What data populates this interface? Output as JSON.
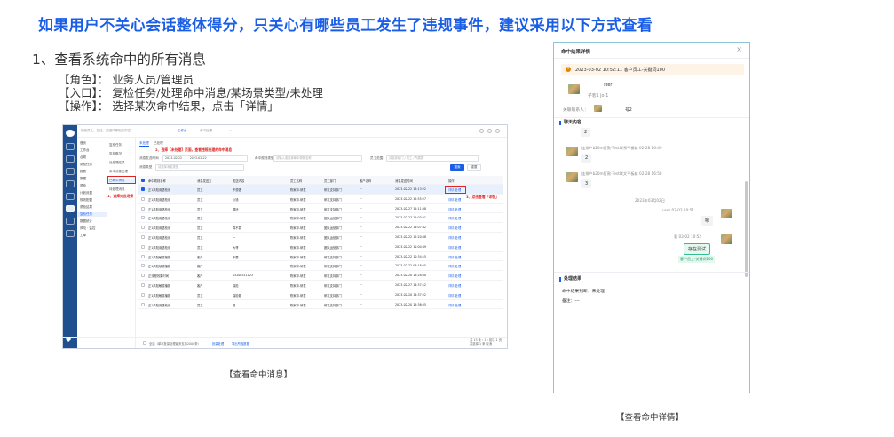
{
  "headline": "如果用户不关心会话整体得分，只关心有哪些员工发生了违规事件，建议采用以下方式查看",
  "subhead": "1、查看系统命中的所有消息",
  "info": {
    "role_label": "【角色】：",
    "role_value": "业务人员/管理员",
    "entry_label": "【入口】：",
    "entry_value": "复检任务/处理命中消息/某场景类型/未处理",
    "op_label": "【操作】：",
    "op_value": "选择某次命中结果，点击「详情」"
  },
  "captions": {
    "left": "【查看命中消息】",
    "right": "【查看命中详情】"
  },
  "screenshot": {
    "search_placeholder": "搜索员工、会话、关键词等相关内容",
    "top_tabs": [
      "工作台",
      "命中处理",
      "···"
    ],
    "nav1": [
      "首页",
      "工作台",
      "合规",
      "质检任务",
      "报表",
      "数据",
      "质检",
      "计划设置",
      "规则配置",
      "质检结果",
      "复检任务",
      "数据统计",
      "风险 · 监控",
      "工单"
    ],
    "nav1_active": "复检任务",
    "nav2": [
      "复检任务",
      "复检概况",
      "已处理结果",
      "命中消息处理",
      "已命中消息",
      "待处理消息"
    ],
    "nav2_active": "已命中消息",
    "content_tabs": [
      "未处理",
      "已处理"
    ],
    "filters": {
      "time_label": "消息发送时间",
      "time_start": "2023-02-22",
      "time_end": "2023-02-22",
      "scene_label": "命中规则类型",
      "scene_placeholder": "请输入或选择命中规则名称",
      "dept_label": "员工范围",
      "dept_placeholder": "请选择部门 / 员工 / 所属群",
      "type_label": "消息类型",
      "type_placeholder": "请选择消息类型"
    },
    "search_btn": "搜索",
    "reset_btn": "重置",
    "columns": [
      "命中规则名称",
      "消息发送方",
      "发送内容",
      "员工名称",
      "员工部门",
      "客户名称",
      "消息发送时间",
      "操作"
    ],
    "rows": [
      [
        "正1风险用语检测",
        "员工",
        "不想做",
        "陈家林-研发",
        "研发支持部门",
        "···",
        "2023-02-22 18:13:22",
        "详情  处理"
      ],
      [
        "正1风险用语检测",
        "员工",
        "价钱",
        "陈家林-研发",
        "研发支持部门",
        "···",
        "2023-02-22 15:55:27",
        "详情  处理"
      ],
      [
        "正1风险用语检测",
        "员工",
        "骚扰",
        "陈家林-研发",
        "研发支持部门",
        "···",
        "2023-02-27 15:11:08",
        "详情  处理"
      ],
      [
        "正1风险用语检测",
        "员工",
        "一",
        "陈家林-研发",
        "团队运营部门",
        "···",
        "2023-02-27 15:03:21",
        "详情  处理"
      ],
      [
        "正1风险用语检测",
        "员工",
        "算不算",
        "陈家林-研发",
        "团队运营部门",
        "···",
        "2023-02-22 14:07:42",
        "详情  处理"
      ],
      [
        "正1风险用语检测",
        "员工",
        "一",
        "陈家林-研发",
        "团队运营部门",
        "···",
        "2023-02-22 12:20:08",
        "详情  处理"
      ],
      [
        "正1风险用语检测",
        "员工",
        "大哥",
        "陈家林-研发",
        "团队运营部门",
        "···",
        "2023-02-22 11:04:09",
        "详情  处理"
      ],
      [
        "正1风险敏感播报",
        "客户",
        "不要",
        "陈家林-研发",
        "研发支持部门",
        "···",
        "2023-02-22 10:34:15",
        "详情  处理"
      ],
      [
        "正1风险敏感播报",
        "客户",
        "一",
        "陈家林-研发",
        "研发支持部门",
        "···",
        "2023-02-22 09:18:55",
        "详情  处理"
      ],
      [
        "正流程效果时间",
        "客户",
        "15208511023",
        "陈家林-研发",
        "研发支持部门",
        "···",
        "2023-02-20 18:28:00",
        "详情  处理"
      ],
      [
        "正1风险敏感播报",
        "客户",
        "保险",
        "陈家林-研发",
        "研发支持部门",
        "···",
        "2023-02-27 14:37:12",
        "详情  处理"
      ],
      [
        "正1风险敏感播报",
        "员工",
        "保险箱",
        "陈家林-研发",
        "研发支持部门",
        "···",
        "2023-02-20 14:37:22",
        "详情  处理"
      ],
      [
        "正1风险用语检测",
        "员工",
        "提",
        "陈家林-研发",
        "研发支持部门",
        "···",
        "2023-02-20 14:36:55",
        "详情  处理"
      ]
    ],
    "pager": "共 13 条   ‹  1  ›   前往  1  页",
    "footer_left": "全选（单次批量处理最多支持2000条）",
    "footer_btn1": "批量处理",
    "footer_btn2": "导出所选数据",
    "footer_right": "共选择 1 条   取消",
    "annot1": "2、选择【未处理】页面，查看违规处理的命中消息",
    "annot2": "1、选择对应场景",
    "annot3": "3、点击查看「详情」"
  },
  "drawer": {
    "title": "命中结果详情",
    "close": "×",
    "alert_icon": "!",
    "alert_text": "2023-03-02 10:52:11  客户员工-关键词100",
    "customer_name": "ster",
    "customer_sub": "子客1  jo-1",
    "related_label": "关联联系人：",
    "related_value": "号2",
    "chat_section": "聊天内容",
    "msgs": [
      {
        "meta": "",
        "text": "2"
      },
      {
        "meta": "连排户b20m打款-Test联系平板轮 02-28 16:49",
        "text": "2"
      },
      {
        "meta": "连排户b20m打款-Test联文平板轮 02-28 16:58",
        "text": "3"
      }
    ],
    "system_msg": "2023年03月02日",
    "right_msg1_meta": "user 03-02 10:51",
    "right_msg1_text": "嗯",
    "right_msg2_meta": "客 03-02 10:52",
    "right_msg2_text": "存在测试",
    "right_tag": "客户员工-关键词100",
    "result_section": "处理结果",
    "result_line1": "命中结果判断：未处理",
    "result_line2": "备注：---"
  }
}
